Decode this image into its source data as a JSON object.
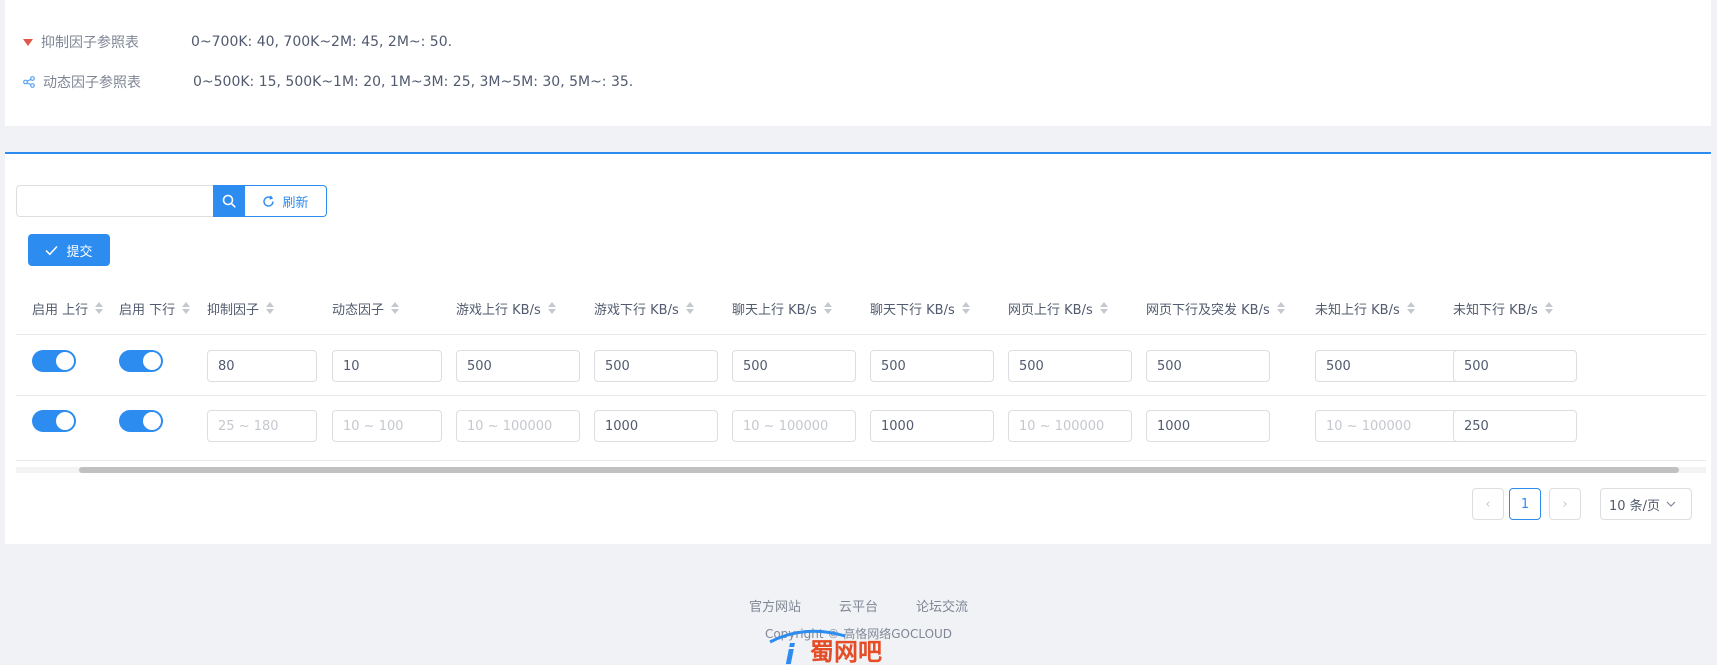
{
  "reference_tables": [
    {
      "label": "抑制因子参照表",
      "value": "0~700K: 40, 700K~2M: 45, 2M~: 50.",
      "icon": "triangle-down-icon",
      "color": "#e0574b"
    },
    {
      "label": "动态因子参照表",
      "value": "0~500K: 15, 500K~1M: 20, 1M~3M: 25, 3M~5M: 30, 5M~: 35.",
      "icon": "share-icon",
      "color": "#5aa5f2"
    }
  ],
  "toolbar": {
    "search_placeholder": "",
    "search_value": "",
    "refresh_label": "刷新",
    "submit_label": "提交"
  },
  "table": {
    "columns": [
      "启用 上行",
      "启用 下行",
      "抑制因子",
      "动态因子",
      "游戏上行 KB/s",
      "游戏下行 KB/s",
      "聊天上行 KB/s",
      "聊天下行 KB/s",
      "网页上行 KB/s",
      "网页下行及突发 KB/s",
      "未知上行 KB/s",
      "未知下行 KB/s"
    ],
    "rows": [
      {
        "enable_up": true,
        "enable_down": true,
        "cells": [
          {
            "value": "80",
            "placeholder": ""
          },
          {
            "value": "10",
            "placeholder": ""
          },
          {
            "value": "500",
            "placeholder": ""
          },
          {
            "value": "500",
            "placeholder": ""
          },
          {
            "value": "500",
            "placeholder": ""
          },
          {
            "value": "500",
            "placeholder": ""
          },
          {
            "value": "500",
            "placeholder": ""
          },
          {
            "value": "500",
            "placeholder": ""
          },
          {
            "value": "500",
            "placeholder": ""
          },
          {
            "value": "500",
            "placeholder": ""
          }
        ]
      },
      {
        "enable_up": true,
        "enable_down": true,
        "cells": [
          {
            "value": "",
            "placeholder": "25 ~ 180"
          },
          {
            "value": "",
            "placeholder": "10 ~ 100"
          },
          {
            "value": "",
            "placeholder": "10 ~ 100000"
          },
          {
            "value": "1000",
            "placeholder": ""
          },
          {
            "value": "",
            "placeholder": "10 ~ 100000"
          },
          {
            "value": "1000",
            "placeholder": ""
          },
          {
            "value": "",
            "placeholder": "10 ~ 100000"
          },
          {
            "value": "1000",
            "placeholder": ""
          },
          {
            "value": "",
            "placeholder": "10 ~ 100000"
          },
          {
            "value": "250",
            "placeholder": ""
          }
        ]
      }
    ]
  },
  "pagination": {
    "prev": "‹",
    "current_page": "1",
    "next": "›",
    "page_size": "10 条/页"
  },
  "footer": {
    "links": [
      "官方网站",
      "云平台",
      "论坛交流"
    ],
    "copyright": "Copyright © 高恪网络GOCLOUD"
  },
  "watermark_text": "i蜀网吧",
  "colors": {
    "primary": "#2d8cf0",
    "background": "#f0f2f5"
  }
}
